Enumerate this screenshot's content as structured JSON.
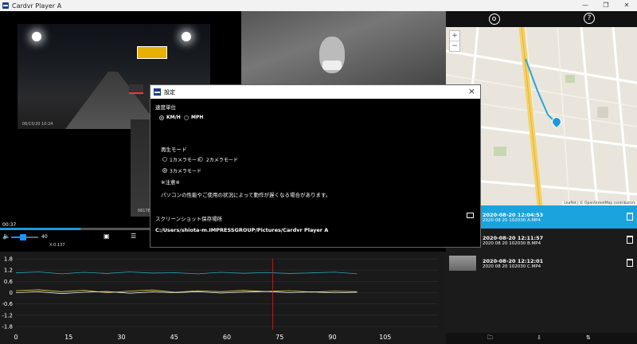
{
  "window": {
    "title": "Cardvr Player A",
    "buttons": [
      "—",
      "❐",
      "✕"
    ]
  },
  "player": {
    "current_time": "00:37",
    "progress_fraction": 0.18,
    "volume": "40",
    "volume_fraction": 0.45,
    "zoom_readout": "X:0.137"
  },
  "graph": {
    "y_ticks": [
      "1.8",
      "1.2",
      "0.6",
      "0",
      "-0.6",
      "-1.2",
      "-1.8"
    ],
    "x_ticks": [
      "0",
      "15",
      "30",
      "45",
      "60",
      "75",
      "90",
      "105"
    ],
    "marker_x": 73,
    "colors": {
      "series1": "#2aa6b8",
      "series2": "#e8d24a",
      "series3": "#e8e8e8",
      "marker": "#cc2222"
    }
  },
  "chart_data": {
    "type": "line",
    "xlim": [
      0,
      120
    ],
    "ylim": [
      -1.8,
      1.8
    ],
    "series": [
      {
        "values": [
          1.05,
          1.1,
          1.0,
          1.08,
          1.02,
          1.1,
          1.04,
          1.06,
          1.0,
          1.08,
          1.03,
          1.07,
          1.02,
          1.05,
          1.09,
          1.0
        ]
      },
      {
        "values": [
          0.1,
          0.15,
          0.05,
          0.12,
          0.0,
          0.08,
          0.14,
          0.02,
          0.1,
          0.05,
          0.12,
          0.06,
          0.1,
          0.03,
          0.08,
          0.05
        ]
      },
      {
        "values": [
          0.0,
          0.05,
          -0.05,
          0.02,
          0.06,
          -0.03,
          0.04,
          0.0,
          0.05,
          -0.02,
          0.03,
          0.06,
          0.0,
          0.04,
          -0.01,
          0.02
        ]
      }
    ]
  },
  "camera": {
    "cam1_timestamp": "06/15/20 10:24",
    "cam3_tag": "0617E0"
  },
  "map": {
    "zoom_in": "+",
    "zoom_out": "−",
    "attribution": "Leaflet | © OpenStreetMap contributors"
  },
  "files": [
    {
      "datetime": "2020-08-20 12:04:53",
      "name": "2020 08 20 102030 A.MP4",
      "selected": true
    },
    {
      "datetime": "2020-08-20 12:11:57",
      "name": "2020 08 20 102030 B.MP4",
      "selected": false
    },
    {
      "datetime": "2020-08-20 12:12:01",
      "name": "2020 08 20 102030 C.MP4",
      "selected": false
    }
  ],
  "settings": {
    "title": "設定",
    "speed_unit_label": "速度単位",
    "speed_options": [
      "KM/H",
      "MPH"
    ],
    "playback_mode_label": "再生モード",
    "playback_options": [
      "1カメラモード",
      "2カメラモード",
      "3カメラモード"
    ],
    "note_label": "※注意※",
    "note_text": "パソコンの性能やご使用の状況によって動作が遅くなる場合があります。",
    "screenshot_label": "スクリーンショット保存場所",
    "screenshot_path": "C:/Users/shiota-m.IMPRESSGROUP/Pictures/Cardvr Player A"
  }
}
